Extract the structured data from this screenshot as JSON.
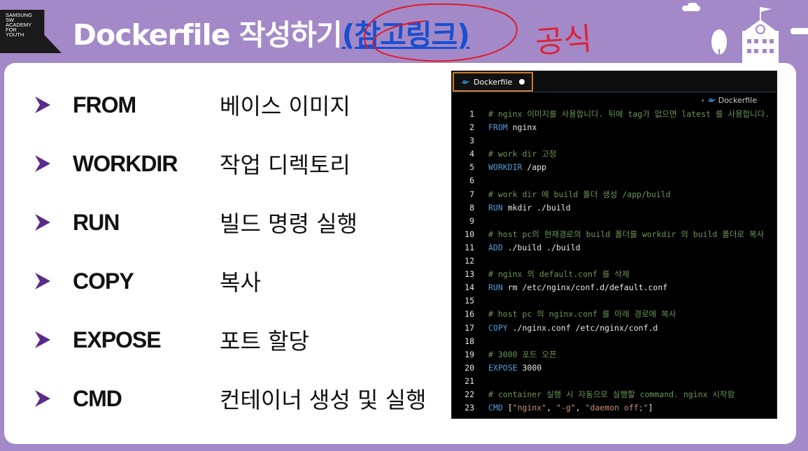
{
  "logo": {
    "lines": [
      "SAMSUNG",
      "SW",
      "ACADEMY",
      "FOR",
      "YOUTH"
    ]
  },
  "title": {
    "main": "Dockerfile 작성하기",
    "link": "(참고링크)"
  },
  "annotation": {
    "handwriting": "공식"
  },
  "items": [
    {
      "command": "FROM",
      "description": "베이스 이미지"
    },
    {
      "command": "WORKDIR",
      "description": "작업 디렉토리"
    },
    {
      "command": "RUN",
      "description": "빌드 명령 실행"
    },
    {
      "command": "COPY",
      "description": "복사"
    },
    {
      "command": "EXPOSE",
      "description": "포트 할당"
    },
    {
      "command": "CMD",
      "description": "컨테이너 생성 및 실행"
    }
  ],
  "editor": {
    "tab_label": "Dockerfile",
    "breadcrumb_separator": "›",
    "breadcrumb": "Dockerfile",
    "lines": [
      {
        "n": "1",
        "parts": [
          {
            "c": "comment",
            "t": "# nginx 이미지를 사용합니다. 뒤에 tag가 없으면 latest 를 사용합니다."
          }
        ]
      },
      {
        "n": "2",
        "parts": [
          {
            "c": "kw",
            "t": "FROM"
          },
          {
            "c": "",
            "t": " nginx"
          }
        ]
      },
      {
        "n": "3",
        "parts": []
      },
      {
        "n": "4",
        "parts": [
          {
            "c": "comment",
            "t": "# work dir 고정"
          }
        ]
      },
      {
        "n": "5",
        "parts": [
          {
            "c": "kw",
            "t": "WORKDIR"
          },
          {
            "c": "",
            "t": " /app"
          }
        ]
      },
      {
        "n": "6",
        "parts": []
      },
      {
        "n": "7",
        "parts": [
          {
            "c": "comment",
            "t": "# work dir 에 build 폴더 생성 /app/build"
          }
        ]
      },
      {
        "n": "8",
        "parts": [
          {
            "c": "kw",
            "t": "RUN"
          },
          {
            "c": "",
            "t": " mkdir ./build"
          }
        ]
      },
      {
        "n": "9",
        "parts": []
      },
      {
        "n": "10",
        "parts": [
          {
            "c": "comment",
            "t": "# host pc의 현재경로의 build 폴더를 workdir 의 build 폴더로 복사"
          }
        ]
      },
      {
        "n": "11",
        "parts": [
          {
            "c": "kw",
            "t": "ADD"
          },
          {
            "c": "",
            "t": " ./build ./build"
          }
        ]
      },
      {
        "n": "12",
        "parts": []
      },
      {
        "n": "13",
        "parts": [
          {
            "c": "comment",
            "t": "# nginx 의 default.conf 를 삭제"
          }
        ]
      },
      {
        "n": "14",
        "parts": [
          {
            "c": "kw",
            "t": "RUN"
          },
          {
            "c": "",
            "t": " rm /etc/nginx/conf.d/default.conf"
          }
        ]
      },
      {
        "n": "15",
        "parts": []
      },
      {
        "n": "16",
        "parts": [
          {
            "c": "comment",
            "t": "# host pc 의 nginx.conf 를 아래 경로에 복사"
          }
        ]
      },
      {
        "n": "17",
        "parts": [
          {
            "c": "kw",
            "t": "COPY"
          },
          {
            "c": "",
            "t": " ./nginx.conf /etc/nginx/conf.d"
          }
        ]
      },
      {
        "n": "18",
        "parts": []
      },
      {
        "n": "19",
        "parts": [
          {
            "c": "comment",
            "t": "# 3000 포트 오픈"
          }
        ]
      },
      {
        "n": "20",
        "parts": [
          {
            "c": "kw",
            "t": "EXPOSE"
          },
          {
            "c": "",
            "t": " 3000"
          }
        ]
      },
      {
        "n": "21",
        "parts": []
      },
      {
        "n": "22",
        "parts": [
          {
            "c": "comment",
            "t": "# container 실행 시 자동으로 실행할 command. nginx 시작함"
          }
        ]
      },
      {
        "n": "23",
        "parts": [
          {
            "c": "kw",
            "t": "CMD"
          },
          {
            "c": "",
            "t": " ["
          },
          {
            "c": "str",
            "t": "\"nginx\""
          },
          {
            "c": "",
            "t": ", "
          },
          {
            "c": "str",
            "t": "\"-g\""
          },
          {
            "c": "",
            "t": ", "
          },
          {
            "c": "str",
            "t": "\"daemon off;\""
          },
          {
            "c": "",
            "t": "]"
          }
        ]
      }
    ]
  },
  "colors": {
    "background": "#a389c7",
    "arrow": "#5b2a8a",
    "link": "#1a4fd0",
    "annotation": "#e11a2a"
  }
}
